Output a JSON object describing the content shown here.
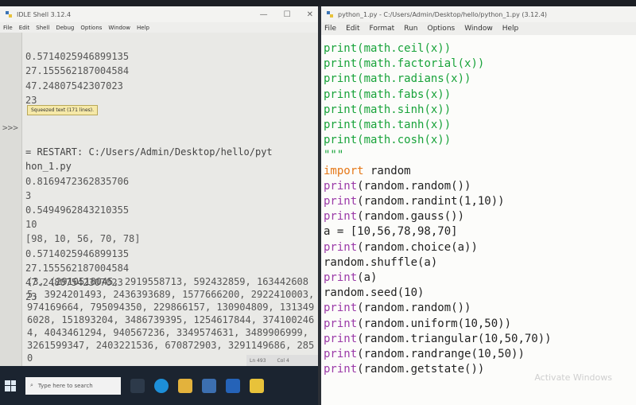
{
  "shell_window": {
    "title": "IDLE Shell 3.12.4",
    "menu": [
      "File",
      "Edit",
      "Shell",
      "Debug",
      "Options",
      "Window",
      "Help"
    ],
    "prompt": ">>>",
    "lines_top": [
      "0.5714025946899135",
      "27.155562187004584",
      "47.24807542307023",
      "23"
    ],
    "squeezed_tooltip": "Squeezed text (171 lines).",
    "restart_line_1": "= RESTART: C:/Users/Admin/Desktop/hello/pyt",
    "restart_line_2": "hon_1.py",
    "lines_after": [
      "0.8169472362835706",
      "3",
      "0.5494962843210355",
      "10",
      "[98, 10, 56, 70, 78]",
      "0.5714025946899135",
      "27.155562187004584",
      "47.24807542307023",
      "23"
    ],
    "state_output": "(3, (2910518045, 2919558713, 592432859, 1634426085, 3924201493, 2436393689, 1577666200, 2922410003, 974169664, 795094350, 229866157, 130904809, 1313496028, 151893204, 3486739395, 1254617844, 3741002464, 4043461294, 940567236, 3349574631, 3489906999, 3261599347, 2403221536, 670872903, 3291149686, 2850",
    "status": {
      "line": "Ln 493",
      "col": "Col 4"
    }
  },
  "editor_window": {
    "title": "python_1.py - C:/Users/Admin/Desktop/hello/python_1.py (3.12.4)",
    "menu": [
      "File",
      "Edit",
      "Format",
      "Run",
      "Options",
      "Window",
      "Help"
    ],
    "code": [
      {
        "kw": "print",
        "rest": "(math.ceil(x))",
        "style": "green"
      },
      {
        "kw": "print",
        "rest": "(math.factorial(x))",
        "style": "green"
      },
      {
        "kw": "print",
        "rest": "(math.radians(x))",
        "style": "green"
      },
      {
        "kw": "print",
        "rest": "(math.fabs(x))",
        "style": "green"
      },
      {
        "kw": "print",
        "rest": "(math.sinh(x))",
        "style": "green"
      },
      {
        "kw": "print",
        "rest": "(math.tanh(x))",
        "style": "green"
      },
      {
        "kw": "print",
        "rest": "(math.cosh(x))",
        "style": "green"
      },
      {
        "kw": "",
        "rest": "\"\"\"",
        "style": "green"
      },
      {
        "kw": "import",
        "rest": " random",
        "style": "import"
      },
      {
        "kw": "print",
        "rest": "(random.random())",
        "style": "print"
      },
      {
        "kw": "print",
        "rest": "(random.randint(1,10))",
        "style": "print"
      },
      {
        "kw": "print",
        "rest": "(random.gauss())",
        "style": "print"
      },
      {
        "kw": "",
        "rest": "a = [10,56,78,98,70]",
        "style": "print"
      },
      {
        "kw": "print",
        "rest": "(random.choice(a))",
        "style": "print"
      },
      {
        "kw": "",
        "rest": "random.shuffle(a)",
        "style": "print"
      },
      {
        "kw": "print",
        "rest": "(a)",
        "style": "print"
      },
      {
        "kw": "",
        "rest": "random.seed(10)",
        "style": "print"
      },
      {
        "kw": "print",
        "rest": "(random.random())",
        "style": "print"
      },
      {
        "kw": "print",
        "rest": "(random.uniform(10,50))",
        "style": "print"
      },
      {
        "kw": "print",
        "rest": "(random.triangular(10,50,70))",
        "style": "print"
      },
      {
        "kw": "print",
        "rest": "(random.randrange(10,50))",
        "style": "print"
      },
      {
        "kw": "print",
        "rest": "(random.getstate())",
        "style": "print"
      }
    ],
    "watermark": "Activate Windows"
  },
  "taskbar": {
    "search_placeholder": "Type here to search"
  }
}
